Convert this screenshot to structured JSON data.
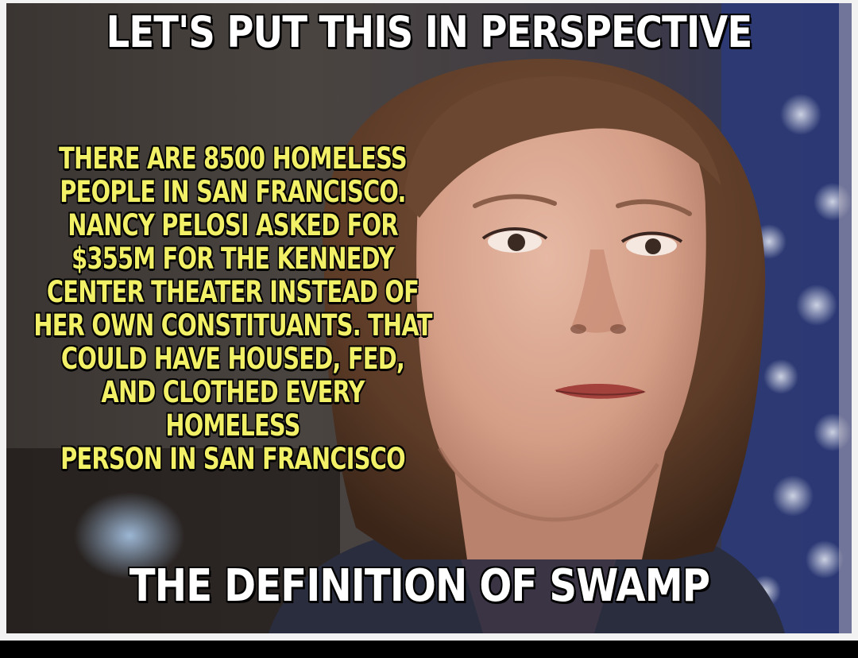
{
  "meme": {
    "top_caption": "LET'S PUT THIS IN PERSPECTIVE",
    "body_lines": [
      "THERE ARE 8500 HOMELESS",
      "PEOPLE IN SAN FRANCISCO.",
      "NANCY PELOSI ASKED FOR",
      "$355M FOR THE KENNEDY",
      "CENTER THEATER INSTEAD OF",
      "HER OWN CONSTITUANTS. THAT",
      "COULD HAVE HOUSED, FED,",
      "AND CLOTHED EVERY HOMELESS",
      "PERSON IN SAN FRANCISCO"
    ],
    "bottom_caption": "THE DEFINITION OF SWAMP"
  },
  "colors": {
    "caption_white": "#ffffff",
    "caption_yellow": "#f2f066",
    "outline": "#000000",
    "frame": "#f2f2f2",
    "letterbox": "#000000"
  }
}
